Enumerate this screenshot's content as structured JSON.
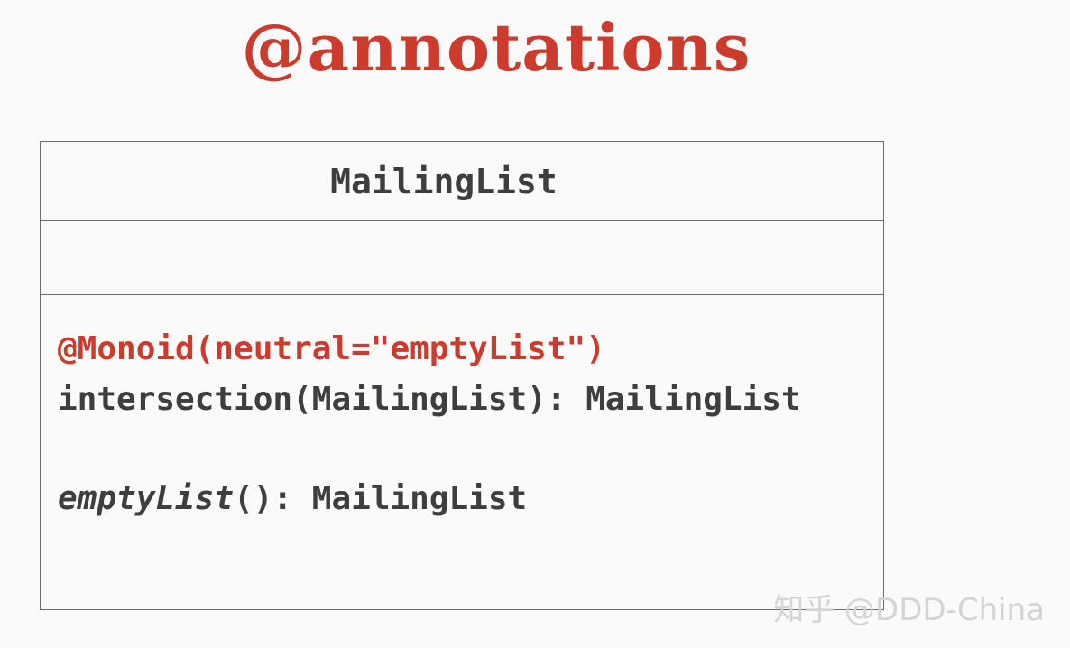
{
  "title": "@annotations",
  "uml_class": {
    "name": "MailingList",
    "annotation": "@Monoid(neutral=\"emptyList\")",
    "operations": [
      {
        "name": "intersection",
        "signature": "(MailingList): MailingList",
        "italic": false
      },
      {
        "name": "emptyList",
        "signature": "(): MailingList",
        "italic": true
      }
    ]
  },
  "watermark": "知乎 @DDD-China",
  "colors": {
    "accent": "#cc3b2b",
    "text": "#3e3e3e",
    "border": "#6b6b6b",
    "background": "#fafafa"
  }
}
